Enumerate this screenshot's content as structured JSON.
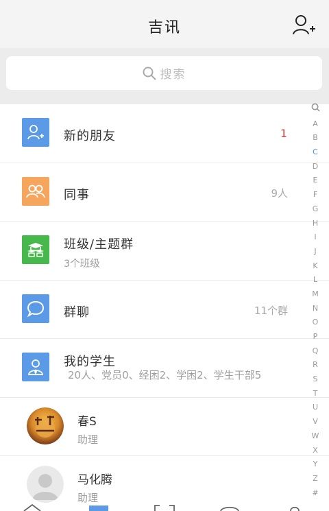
{
  "header": {
    "title": "吉讯",
    "add_icon": "add-friend-icon"
  },
  "search": {
    "placeholder": "搜索",
    "icon": "search-icon"
  },
  "rows": [
    {
      "title": "新的朋友",
      "right": "1",
      "icon": "add-friend-icon",
      "color": "#5b9ae6"
    },
    {
      "title": "同事",
      "right": "9人",
      "icon": "colleagues-icon",
      "color": "#f5a55c"
    },
    {
      "title": "班级/主题群",
      "sub": "3个班级",
      "icon": "class-group-icon",
      "color": "#46b84c"
    },
    {
      "title": "群聊",
      "right": "11个群",
      "icon": "chat-bubble-icon",
      "color": "#5b9ae6"
    },
    {
      "title": "我的学生",
      "sub": "20人、党员0、经困2、学困2、学生干部5",
      "icon": "student-icon",
      "color": "#5b9ae6"
    }
  ],
  "contacts": [
    {
      "name": "春S",
      "role": "助理"
    },
    {
      "name": "马化腾",
      "role": "助理"
    }
  ],
  "index": [
    "A",
    "B",
    "C",
    "D",
    "E",
    "F",
    "G",
    "H",
    "I",
    "J",
    "K",
    "L",
    "M",
    "N",
    "O",
    "P",
    "Q",
    "R",
    "S",
    "T",
    "U",
    "V",
    "W",
    "X",
    "Y",
    "Z",
    "#"
  ],
  "index_active": "C",
  "colors": {
    "accent": "#5b9ae6",
    "badge": "#e23a3a"
  }
}
